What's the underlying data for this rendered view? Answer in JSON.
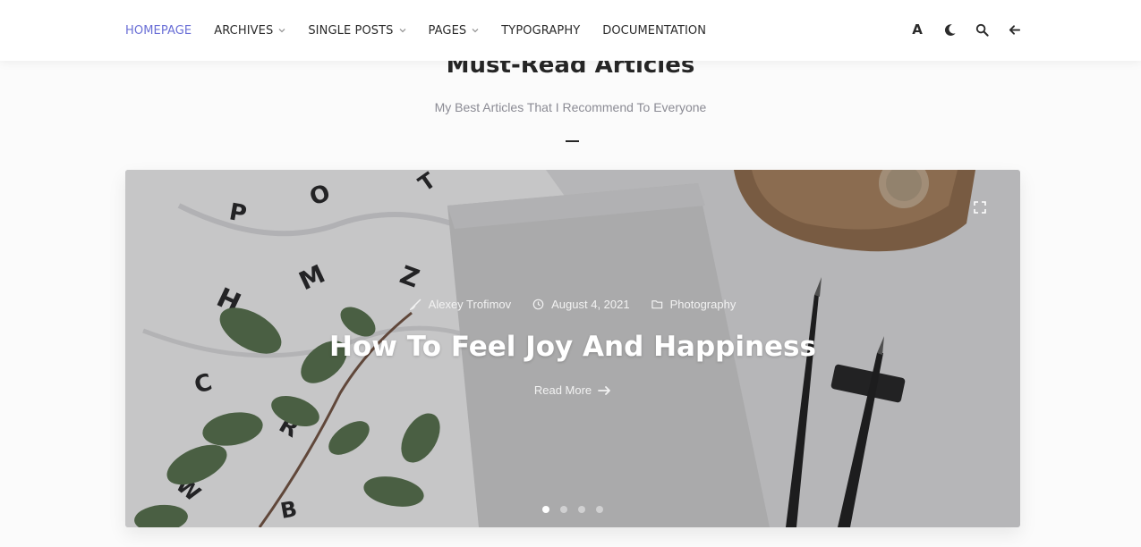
{
  "nav": {
    "items": [
      {
        "label": "HOMEPAGE",
        "active": true,
        "dropdown": false
      },
      {
        "label": "ARCHIVES",
        "active": false,
        "dropdown": true
      },
      {
        "label": "SINGLE POSTS",
        "active": false,
        "dropdown": true
      },
      {
        "label": "PAGES",
        "active": false,
        "dropdown": true
      },
      {
        "label": "TYPOGRAPHY",
        "active": false,
        "dropdown": false
      },
      {
        "label": "DOCUMENTATION",
        "active": false,
        "dropdown": false
      }
    ],
    "tools": {
      "font_size_label": "A",
      "icons": [
        "font-size-icon",
        "moon-icon",
        "search-icon",
        "arrow-left-icon"
      ]
    },
    "accent_color": "#6a6fd6"
  },
  "section": {
    "title": "Must-Read Articles",
    "subtitle": "My Best Articles That I Recommend To Everyone"
  },
  "slider": {
    "author": "Alexey Trofimov",
    "date": "August 4, 2021",
    "category": "Photography",
    "title": "How To Feel Joy And Happiness",
    "read_more": "Read More",
    "slide_count": 4,
    "active_slide": 1
  }
}
